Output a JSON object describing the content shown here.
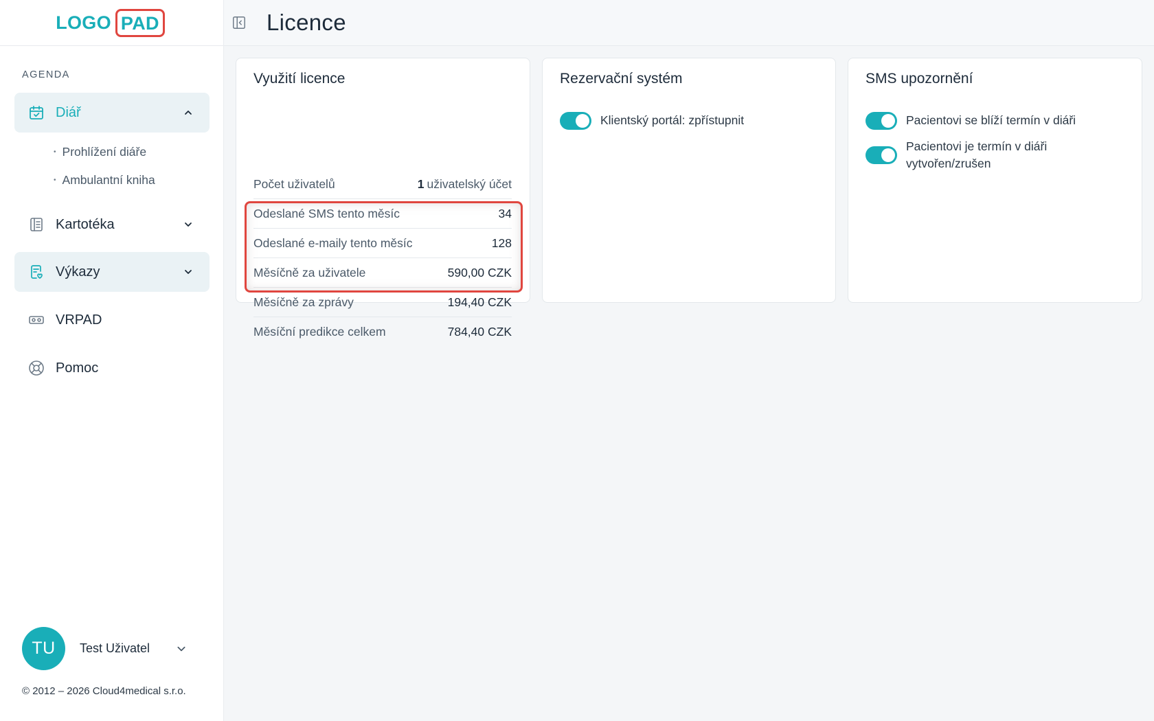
{
  "logo": {
    "part1": "LOGO",
    "part2": "PAD"
  },
  "sidebar": {
    "section_label": "AGENDA",
    "items": [
      {
        "label": "Diář",
        "icon": "calendar-check-icon",
        "expanded": true,
        "children": [
          {
            "label": "Prohlížení diáře"
          },
          {
            "label": "Ambulantní kniha"
          }
        ]
      },
      {
        "label": "Kartotéka",
        "icon": "book-icon"
      },
      {
        "label": "Výkazy",
        "icon": "report-icon"
      },
      {
        "label": "VRPAD",
        "icon": "vr-headset-icon"
      },
      {
        "label": "Pomoc",
        "icon": "lifebuoy-icon"
      }
    ],
    "user": {
      "initials": "TU",
      "name": "Test Uživatel"
    },
    "copyright": "© 2012 – 2026 Cloud4medical s.r.o."
  },
  "header": {
    "title": "Licence"
  },
  "cards": {
    "usage": {
      "title": "Využití licence",
      "rows": [
        {
          "label": "Počet uživatelů",
          "value_strong": "1",
          "value_rest": "uživatelský účet"
        },
        {
          "label": "Odeslané SMS tento měsíc",
          "value": "34"
        },
        {
          "label": "Odeslané e-maily tento měsíc",
          "value": "128"
        },
        {
          "label": "Měsíčně za uživatele",
          "value": "590,00 CZK"
        },
        {
          "label": "Měsíčně za zprávy",
          "value": "194,40 CZK"
        },
        {
          "label": "Měsíční predikce celkem",
          "value": "784,40 CZK"
        }
      ]
    },
    "reservation": {
      "title": "Rezervační systém",
      "toggles": [
        {
          "label": "Klientský portál: zpřístupnit",
          "on": true
        }
      ]
    },
    "sms": {
      "title": "SMS upozornění",
      "toggles": [
        {
          "label": "Pacientovi se blíží termín v diáři",
          "on": true
        },
        {
          "label": "Pacientovi je termín v diáři vytvořen/zrušen",
          "on": true
        }
      ]
    }
  },
  "colors": {
    "accent": "#19aeb8",
    "highlight": "#e0463f",
    "text": "#1d2b3a"
  }
}
